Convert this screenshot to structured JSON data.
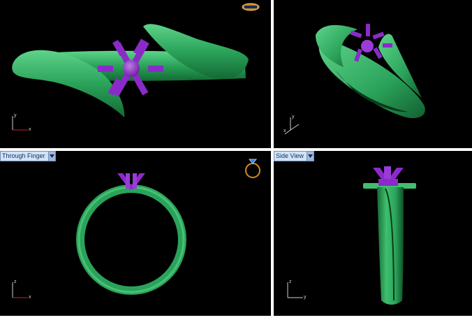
{
  "viewports": {
    "top_left": {
      "label": "",
      "axis": {
        "vertical": "y",
        "horizontal": "x"
      }
    },
    "top_right": {
      "label": "",
      "axis": {
        "vertical": "y",
        "horizontal": "x"
      }
    },
    "bottom_left": {
      "label": "Through Finger",
      "axis": {
        "vertical": "z",
        "horizontal": "x"
      }
    },
    "bottom_right": {
      "label": "Side View",
      "axis": {
        "vertical": "z",
        "horizontal": "y"
      }
    }
  },
  "icons": {
    "dropdown": "chevron-down-icon",
    "badge": "brand-logo-icon",
    "ring_preview": "ring-icon"
  },
  "colors": {
    "ring_green": "#2aa35a",
    "prong_purple": "#8a2bc9",
    "background": "#000000",
    "separator": "#ffffff",
    "label_bg": "#cfe3f7"
  }
}
